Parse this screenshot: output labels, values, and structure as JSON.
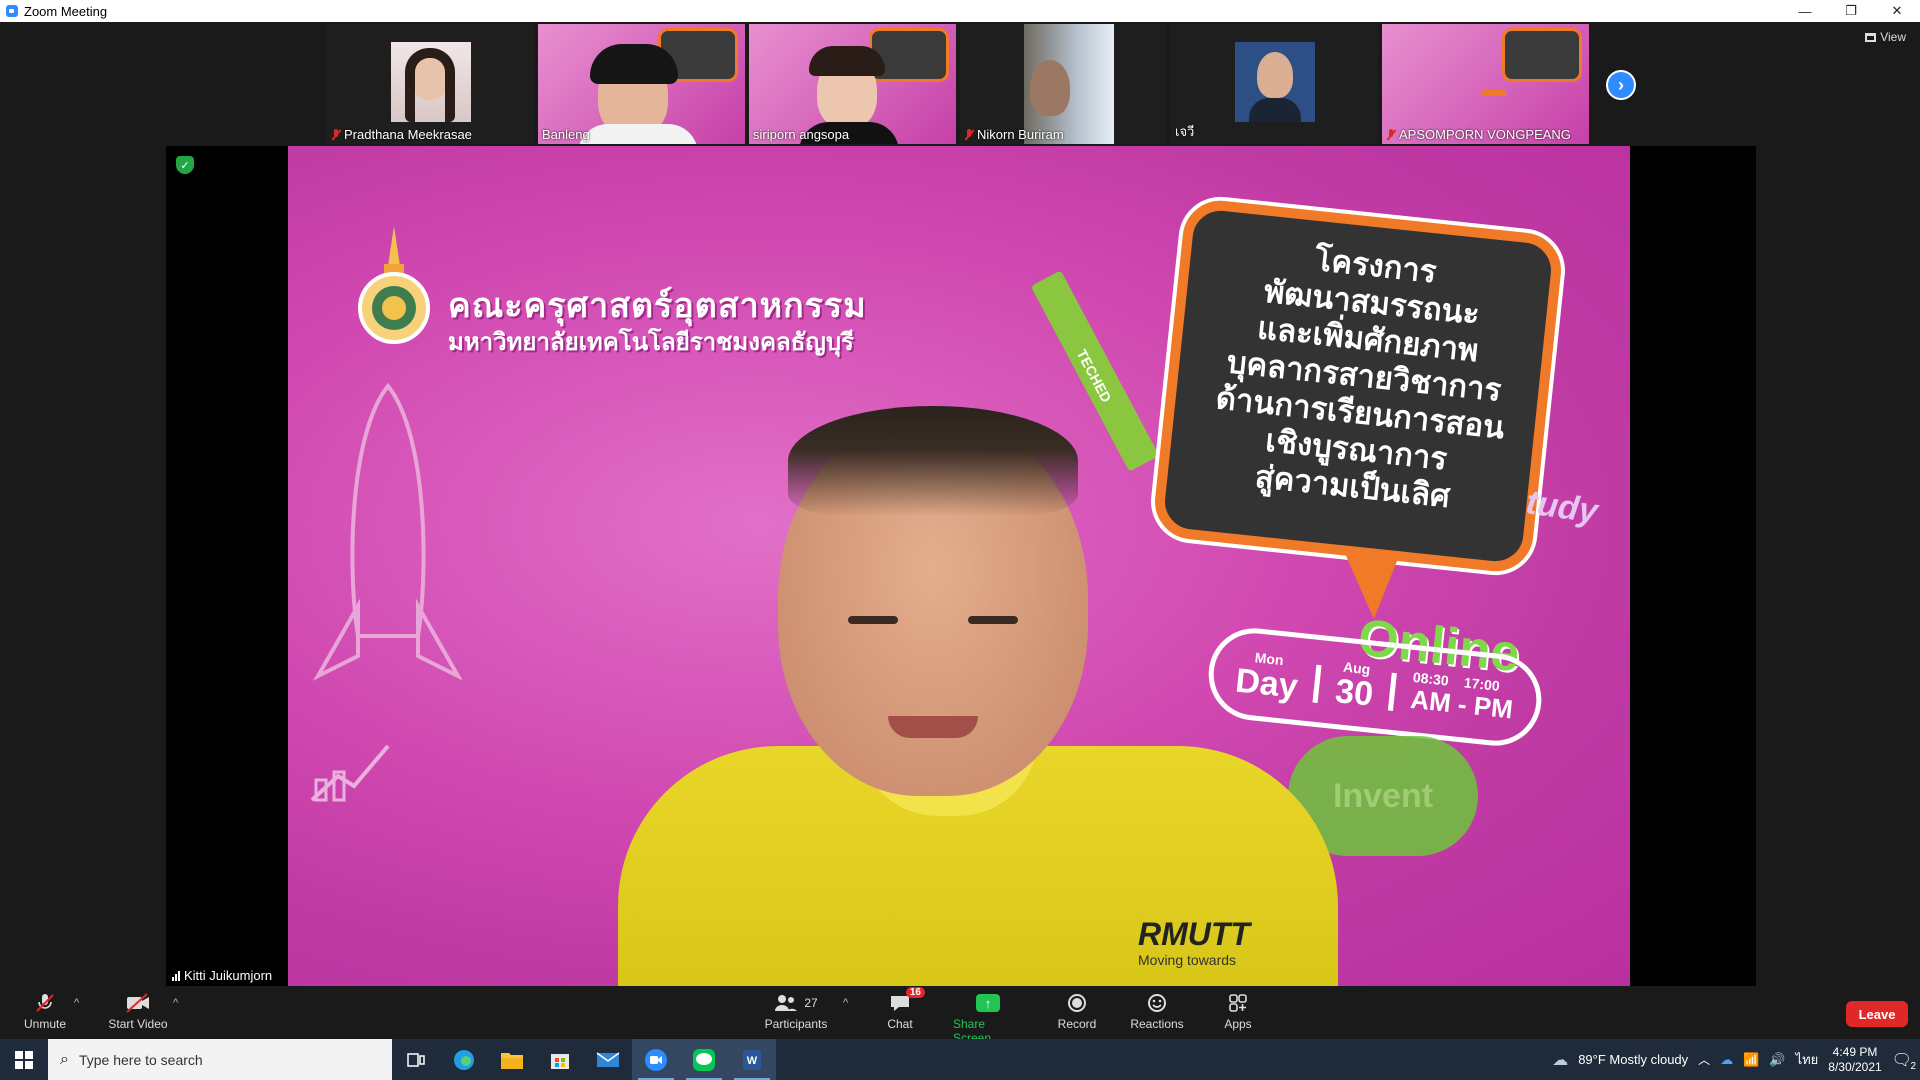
{
  "window": {
    "title": "Zoom Meeting",
    "min": "—",
    "restore": "❐",
    "close": "✕"
  },
  "view": {
    "label": "View"
  },
  "participants_strip": [
    {
      "name": "Pradthana Meekrasae",
      "muted": true
    },
    {
      "name": "Banleng",
      "muted": false
    },
    {
      "name": "siriporn angsopa",
      "muted": false
    },
    {
      "name": "Nikorn Buriram",
      "muted": true
    },
    {
      "name": "เจวี",
      "muted": false
    },
    {
      "name": "APSOMPORN VONGPEANG",
      "muted": true
    }
  ],
  "main": {
    "speaker": "Kitti Juikumjorn",
    "slide": {
      "faculty": "คณะครุศาสตร์อุตสาหกรรม",
      "university": "มหาวิทยาลัยเทคโนโลยีราชมงคลธัญบุรี",
      "bubble_lines": [
        "โครงการ",
        "พัฒนาสมรรถนะ",
        "และเพิ่มศักยภาพ",
        "บุคลากรสายวิชาการ",
        "ด้านการเรียนการสอน",
        "เชิงบูรณาการ",
        "สู่ความเป็นเลิศ"
      ],
      "pencil_label": "TECHED",
      "online": "Online",
      "date": {
        "dow": "Mon",
        "day_word": "Day",
        "month": "Aug",
        "day": "30",
        "start_time": "08:30",
        "start_ampm": "AM",
        "dash": "-",
        "end_time": "17:00",
        "end_ampm": "PM"
      },
      "invent": "Invent",
      "study": "tudy",
      "shirt_brand": "RMUTT",
      "shirt_tagline": "Moving towards"
    }
  },
  "toolbar": {
    "unmute": "Unmute",
    "start_video": "Start Video",
    "participants": "Participants",
    "participants_count": "27",
    "chat": "Chat",
    "chat_badge": "16",
    "share": "Share Screen",
    "record": "Record",
    "reactions": "Reactions",
    "apps": "Apps",
    "leave": "Leave"
  },
  "taskbar": {
    "search_placeholder": "Type here to search",
    "weather": "89°F  Mostly cloudy",
    "lang": "ไทย",
    "time": "4:49 PM",
    "date": "8/30/2021",
    "notif_count": "2"
  },
  "colors": {
    "zoom_blue": "#2d8cff",
    "share_green": "#23c552",
    "leave_red": "#e02828",
    "slide_pink": "#d048b0"
  }
}
